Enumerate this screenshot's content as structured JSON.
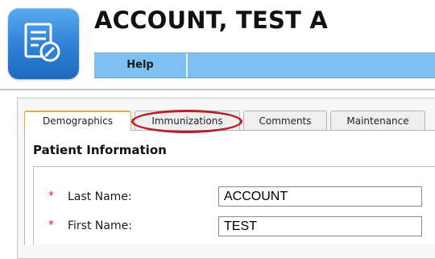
{
  "patient": {
    "name": "ACCOUNT, TEST A"
  },
  "app_icon": {
    "icon": "edit-form-icon",
    "color": "#2e7fd6"
  },
  "menu": {
    "help_label": "Help",
    "bar_color": "#7ec0f2"
  },
  "tabs": [
    {
      "label": "Demographics",
      "active": true
    },
    {
      "label": "Immunizations",
      "active": false,
      "highlighted": true
    },
    {
      "label": "Comments",
      "active": false
    },
    {
      "label": "Maintenance",
      "active": false
    }
  ],
  "section": {
    "title": "Patient Information"
  },
  "fields": {
    "last_name": {
      "required_marker": "*",
      "label": "Last Name:",
      "value": "ACCOUNT"
    },
    "first_name": {
      "required_marker": "*",
      "label": "First Name:",
      "value": "TEST"
    }
  },
  "colors": {
    "active_tab_accent": "#f0a838",
    "highlight_ring": "#b3222a",
    "required": "#d8242b"
  }
}
